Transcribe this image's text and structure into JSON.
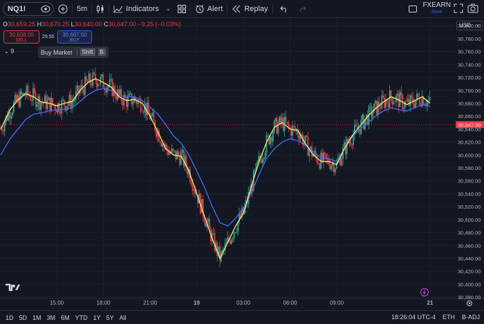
{
  "toolbar": {
    "symbol": "NQ1!",
    "interval": "5m",
    "indicators_label": "Indicators",
    "alert_label": "Alert",
    "replay_label": "Replay",
    "account_name": "FXEARN",
    "save_label": "Save"
  },
  "ohlc": {
    "o_key": "O",
    "o_val": "30,659.25",
    "h_key": "H",
    "h_val": "30,670.25",
    "l_key": "L",
    "l_val": "30,640.00",
    "c_key": "C",
    "c_val": "30,647.00",
    "change": "−9.25 (−0.03%)"
  },
  "trade": {
    "sell_price": "30,638.00",
    "sell_label": "SELL",
    "spread": "29.50",
    "buy_price": "30,667.50",
    "buy_label": "BUY"
  },
  "indicator_toggle": "9",
  "tooltip": {
    "text": "Buy Market",
    "key1": "Shift",
    "key2": "B"
  },
  "currency": "USD",
  "status": {
    "time": "18:26:04 UTC-4",
    "session": "ETH",
    "adj": "B-ADJ"
  },
  "timeframes": [
    "1D",
    "5D",
    "1M",
    "3M",
    "6M",
    "YTD",
    "1Y",
    "5Y",
    "All"
  ],
  "colors": {
    "up": "#22ab94",
    "down": "#f23645",
    "ema_fast": "#f5e663",
    "ema_slow": "#3d6bf2",
    "background": "#131722"
  },
  "chart_data": {
    "type": "candlestick",
    "price_axis_ticks": [
      "30,800.00",
      "30,780.00",
      "30,760.00",
      "30,740.00",
      "30,720.00",
      "30,700.00",
      "30,680.00",
      "30,660.00",
      "30,640.00",
      "30,620.00",
      "30,600.00",
      "30,580.00",
      "30,560.00",
      "30,540.00",
      "30,520.00",
      "30,500.00",
      "30,480.00",
      "30,460.00",
      "30,440.00",
      "30,420.00",
      "30,400.00",
      "30,380.00"
    ],
    "price_axis_values": [
      30800,
      30780,
      30760,
      30740,
      30720,
      30700,
      30680,
      30660,
      30640,
      30620,
      30600,
      30580,
      30560,
      30540,
      30520,
      30500,
      30480,
      30460,
      30440,
      30420,
      30400,
      30380
    ],
    "ylim": [
      30378,
      30812
    ],
    "time_axis_labels": [
      "15:00",
      "18:00",
      "21:00",
      "19",
      "03:00",
      "06:00",
      "09:00",
      "21"
    ],
    "time_axis_hours": [
      15,
      18,
      21,
      24,
      27,
      30,
      33,
      39
    ],
    "xlim": [
      11.35,
      40.6
    ],
    "current_price_label": "30,647.00",
    "current_price": 30647,
    "ema_fast_points": [
      [
        11.4,
        30640
      ],
      [
        12.0,
        30670
      ],
      [
        12.5,
        30685
      ],
      [
        13.0,
        30695
      ],
      [
        13.5,
        30690
      ],
      [
        14.0,
        30682
      ],
      [
        14.5,
        30680
      ],
      [
        15.0,
        30676
      ],
      [
        15.5,
        30680
      ],
      [
        16.0,
        30683
      ],
      [
        16.5,
        30700
      ],
      [
        17.0,
        30712
      ],
      [
        17.5,
        30718
      ],
      [
        18.0,
        30712
      ],
      [
        18.5,
        30705
      ],
      [
        19.0,
        30690
      ],
      [
        19.5,
        30684
      ],
      [
        20.0,
        30686
      ],
      [
        20.5,
        30680
      ],
      [
        21.0,
        30660
      ],
      [
        21.5,
        30636
      ],
      [
        22.0,
        30610
      ],
      [
        22.5,
        30600
      ],
      [
        23.0,
        30598
      ],
      [
        23.5,
        30575
      ],
      [
        24.0,
        30540
      ],
      [
        24.5,
        30505
      ],
      [
        25.0,
        30470
      ],
      [
        25.5,
        30440
      ],
      [
        26.0,
        30465
      ],
      [
        26.5,
        30490
      ],
      [
        27.0,
        30510
      ],
      [
        27.5,
        30550
      ],
      [
        28.0,
        30590
      ],
      [
        28.5,
        30620
      ],
      [
        29.0,
        30643
      ],
      [
        29.5,
        30650
      ],
      [
        30.0,
        30640
      ],
      [
        30.5,
        30638
      ],
      [
        31.0,
        30617
      ],
      [
        31.5,
        30600
      ],
      [
        32.0,
        30590
      ],
      [
        32.5,
        30590
      ],
      [
        33.0,
        30585
      ],
      [
        33.5,
        30610
      ],
      [
        34.0,
        30630
      ],
      [
        34.5,
        30645
      ],
      [
        35.0,
        30660
      ],
      [
        35.5,
        30672
      ],
      [
        36.0,
        30682
      ],
      [
        36.5,
        30690
      ],
      [
        37.0,
        30685
      ],
      [
        37.5,
        30678
      ],
      [
        38.0,
        30684
      ],
      [
        38.5,
        30690
      ],
      [
        39.0,
        30680
      ]
    ],
    "ema_slow_points": [
      [
        11.4,
        30600
      ],
      [
        12.0,
        30625
      ],
      [
        12.5,
        30640
      ],
      [
        13.0,
        30655
      ],
      [
        13.5,
        30663
      ],
      [
        14.0,
        30665
      ],
      [
        14.5,
        30668
      ],
      [
        15.0,
        30670
      ],
      [
        15.5,
        30671
      ],
      [
        16.0,
        30673
      ],
      [
        16.5,
        30683
      ],
      [
        17.0,
        30693
      ],
      [
        17.5,
        30700
      ],
      [
        18.0,
        30703
      ],
      [
        18.5,
        30700
      ],
      [
        19.0,
        30692
      ],
      [
        19.5,
        30690
      ],
      [
        20.0,
        30690
      ],
      [
        20.5,
        30684
      ],
      [
        21.0,
        30674
      ],
      [
        21.5,
        30663
      ],
      [
        22.0,
        30647
      ],
      [
        22.5,
        30630
      ],
      [
        23.0,
        30618
      ],
      [
        23.5,
        30600
      ],
      [
        24.0,
        30575
      ],
      [
        24.5,
        30550
      ],
      [
        25.0,
        30520
      ],
      [
        25.5,
        30495
      ],
      [
        26.0,
        30490
      ],
      [
        26.5,
        30502
      ],
      [
        27.0,
        30518
      ],
      [
        27.5,
        30540
      ],
      [
        28.0,
        30570
      ],
      [
        28.5,
        30595
      ],
      [
        29.0,
        30610
      ],
      [
        29.5,
        30620
      ],
      [
        30.0,
        30625
      ],
      [
        30.5,
        30622
      ],
      [
        31.0,
        30615
      ],
      [
        31.5,
        30605
      ],
      [
        32.0,
        30595
      ],
      [
        32.5,
        30594
      ],
      [
        33.0,
        30590
      ],
      [
        33.5,
        30610
      ],
      [
        34.0,
        30628
      ],
      [
        34.5,
        30640
      ],
      [
        35.0,
        30650
      ],
      [
        35.5,
        30660
      ],
      [
        36.0,
        30668
      ],
      [
        36.5,
        30673
      ],
      [
        37.0,
        30670
      ],
      [
        37.5,
        30668
      ],
      [
        38.0,
        30673
      ],
      [
        38.5,
        30678
      ],
      [
        39.0,
        30675
      ]
    ]
  }
}
